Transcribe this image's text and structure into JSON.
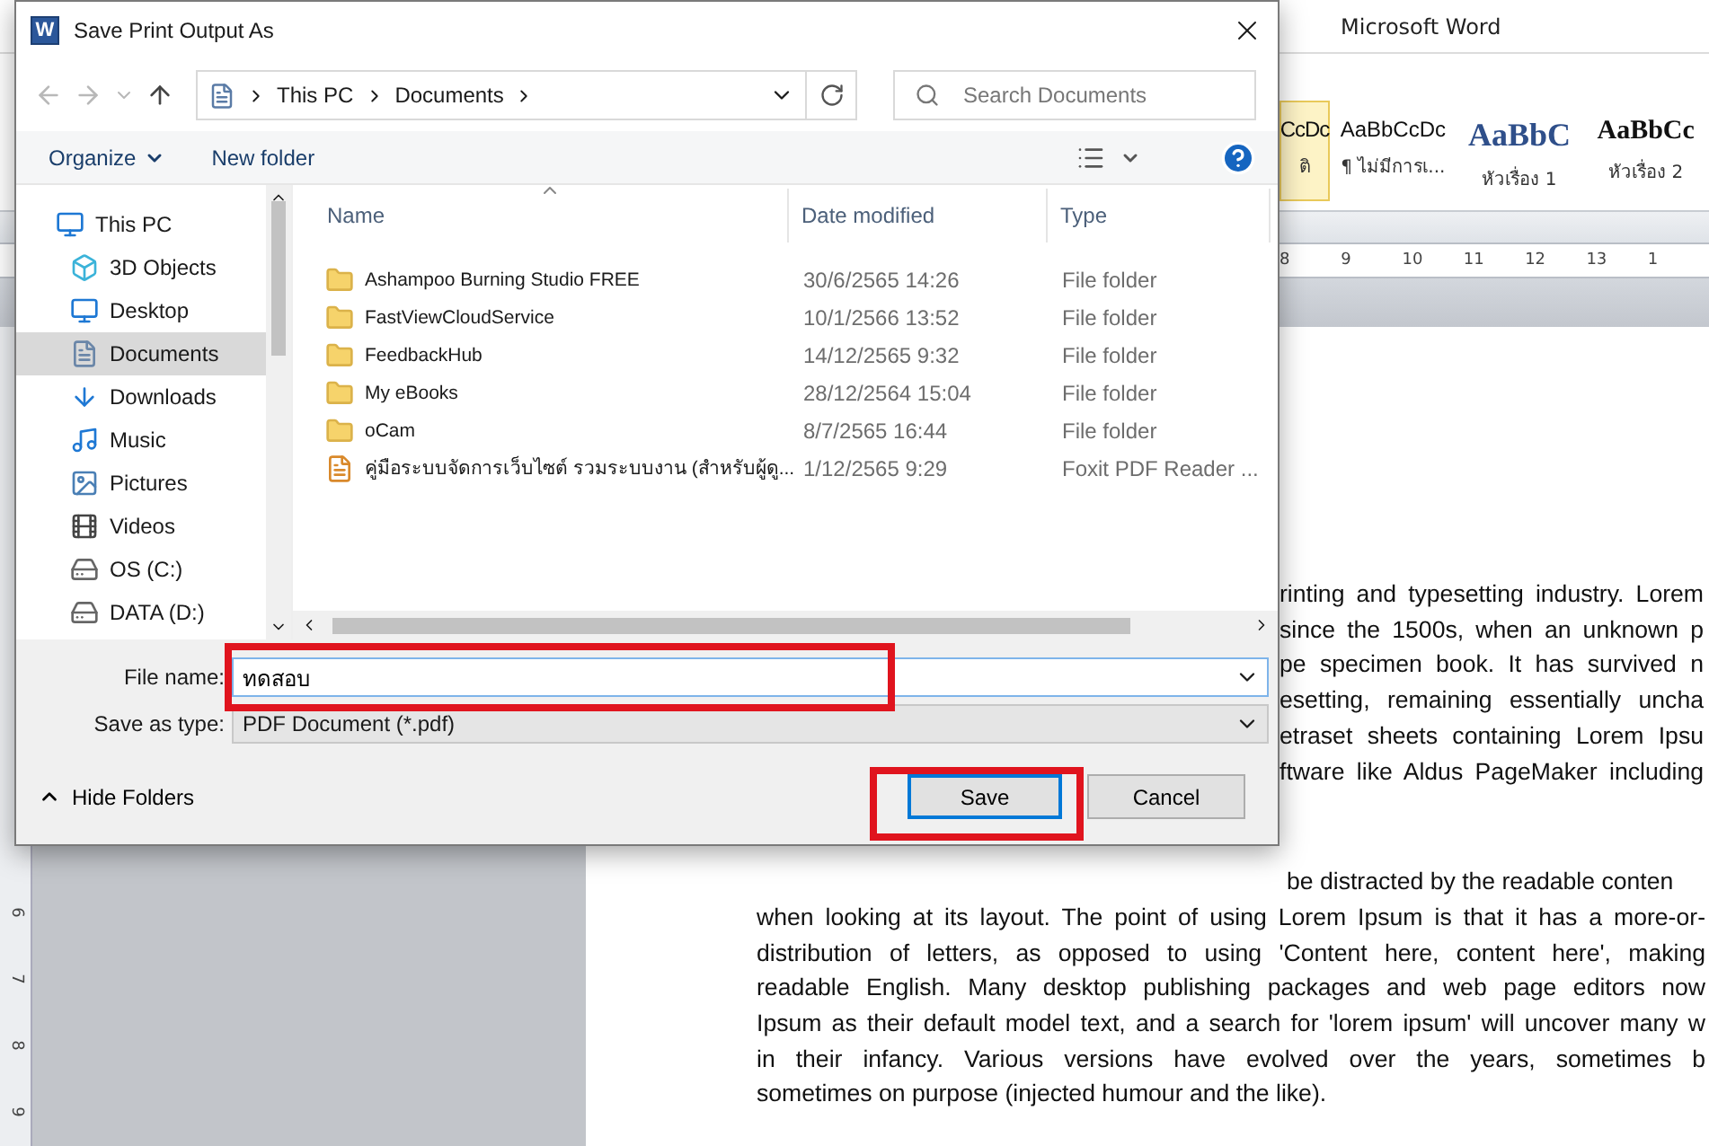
{
  "word_window": {
    "title": "Microsoft Word",
    "styles": [
      {
        "preview": "CcDc",
        "label": "ติ",
        "kind": "normal",
        "selected": true
      },
      {
        "preview": "AaBbCcDc",
        "label": "¶ ไม่มีการเ...",
        "kind": "normal",
        "selected": false
      },
      {
        "preview": "AaBbC",
        "label": "หัวเรื่อง 1",
        "kind": "heading1",
        "selected": false
      },
      {
        "preview": "AaBbCc",
        "label": "หัวเรื่อง 2",
        "kind": "heading2",
        "selected": false
      }
    ],
    "ruler_marks": [
      "8",
      "9",
      "10",
      "11",
      "12",
      "13",
      "1"
    ],
    "vertical_ruler_marks": [
      "6",
      "7",
      "8",
      "9"
    ],
    "document": {
      "paragraph_1_lines": [
        "rinting and typesetting industry. Lorem",
        "since the 1500s, when an unknown p",
        "pe specimen book. It has survived n",
        "esetting, remaining essentially uncha",
        "etraset sheets containing Lorem Ipsu",
        "ftware like Aldus PageMaker including"
      ],
      "paragraph_2_lines": [
        "be distracted by the readable conten",
        "when looking at its layout. The point of using Lorem Ipsum is that it has a more-or-",
        "distribution of letters, as opposed to using 'Content here, content here', making",
        "readable English. Many desktop publishing packages and web page editors now",
        "Ipsum as their default model text, and a search for 'lorem ipsum' will uncover many w",
        "in their infancy. Various versions have evolved over the years, sometimes b",
        "sometimes on purpose (injected humour and the like)."
      ]
    }
  },
  "dialog": {
    "logo_letter": "W",
    "title": "Save Print Output As",
    "breadcrumb": [
      "This PC",
      "Documents"
    ],
    "search": {
      "placeholder": "Search Documents"
    },
    "toolbar": {
      "organize": "Organize",
      "new_folder": "New folder"
    },
    "sidebar": {
      "items": [
        {
          "label": "This PC",
          "selected": false
        },
        {
          "label": "3D Objects",
          "selected": false
        },
        {
          "label": "Desktop",
          "selected": false
        },
        {
          "label": "Documents",
          "selected": true
        },
        {
          "label": "Downloads",
          "selected": false
        },
        {
          "label": "Music",
          "selected": false
        },
        {
          "label": "Pictures",
          "selected": false
        },
        {
          "label": "Videos",
          "selected": false
        },
        {
          "label": "OS (C:)",
          "selected": false
        },
        {
          "label": "DATA (D:)",
          "selected": false
        }
      ]
    },
    "table": {
      "columns": [
        "Name",
        "Date modified",
        "Type"
      ],
      "rows": [
        {
          "kind": "folder",
          "name": "Ashampoo Burning Studio FREE",
          "date": "30/6/2565 14:26",
          "type": "File folder"
        },
        {
          "kind": "folder",
          "name": "FastViewCloudService",
          "date": "10/1/2566 13:52",
          "type": "File folder"
        },
        {
          "kind": "folder",
          "name": "FeedbackHub",
          "date": "14/12/2565 9:32",
          "type": "File folder"
        },
        {
          "kind": "folder",
          "name": "My eBooks",
          "date": "28/12/2564 15:04",
          "type": "File folder"
        },
        {
          "kind": "folder",
          "name": "oCam",
          "date": "8/7/2565 16:44",
          "type": "File folder"
        },
        {
          "kind": "pdf",
          "name": "คู่มือระบบจัดการเว็บไซต์ รวมระบบงาน (สำหรับผู้ดู...",
          "date": "1/12/2565 9:29",
          "type": "Foxit PDF Reader ..."
        }
      ]
    },
    "file_name": {
      "label": "File name:",
      "value": "ทดสอบ"
    },
    "save_as_type": {
      "label": "Save as type:",
      "value": "PDF Document (*.pdf)"
    },
    "hide_folders": "Hide Folders",
    "buttons": [
      {
        "label": "Save",
        "default": true
      },
      {
        "label": "Cancel",
        "default": false
      }
    ]
  }
}
